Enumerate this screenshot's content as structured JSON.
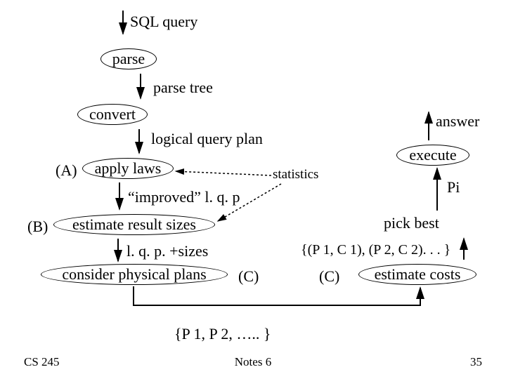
{
  "labels": {
    "sql_query": "SQL query",
    "parse": "parse",
    "parse_tree": "parse tree",
    "convert": "convert",
    "logical_qp": "logical query plan",
    "A": "(A)",
    "apply_laws": "apply laws",
    "improved_lqp": "“improved” l. q. p",
    "B": "(B)",
    "estimate_sizes": "estimate result sizes",
    "lqp_sizes": "l. q. p. +sizes",
    "consider_plans": "consider physical plans",
    "C_left": "(C)",
    "plan_set": "{P 1, P 2, ….. }",
    "statistics": "statistics",
    "pair_set": "{(P 1, C 1), (P 2, C 2). . . }",
    "C_right": "(C)",
    "estimate_costs": "estimate costs",
    "pick_best": "pick best",
    "Pi": "Pi",
    "execute": "execute",
    "answer": "answer"
  },
  "footer": {
    "course": "CS 245",
    "notes": "Notes 6",
    "page": "35"
  }
}
